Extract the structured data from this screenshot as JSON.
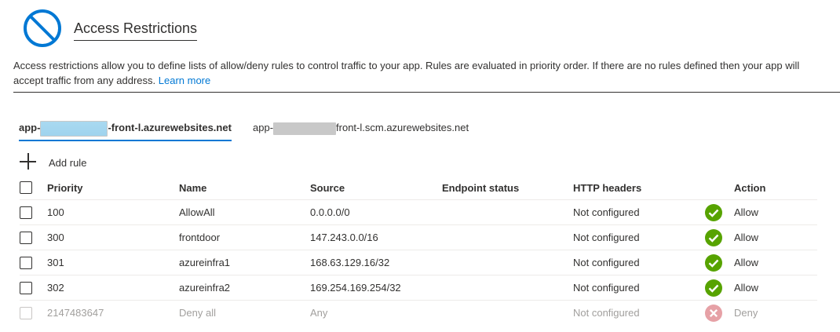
{
  "header": {
    "icon": "blocked-circle-icon",
    "title": "Access Restrictions"
  },
  "description": {
    "line1": "Access restrictions allow you to define lists of allow/deny rules to control traffic to your app. Rules are evaluated in priority order. If there are no rules defined then your app will",
    "line2": "accept traffic from any address.",
    "learn_more": "Learn more"
  },
  "tabs": [
    {
      "prefix": "app-",
      "suffix": "-front-l.azurewebsites.net",
      "selected": true
    },
    {
      "prefix": "app-",
      "suffix": "front-l.scm.azurewebsites.net",
      "selected": false
    }
  ],
  "toolbar": {
    "add_rule_label": "Add rule",
    "add_icon": "plus-icon"
  },
  "table": {
    "columns": {
      "priority": "Priority",
      "name": "Name",
      "source": "Source",
      "endpoint_status": "Endpoint status",
      "http_headers": "HTTP headers",
      "action": "Action"
    },
    "rows": [
      {
        "priority": "100",
        "name": "AllowAll",
        "source": "0.0.0.0/0",
        "endpoint_status": "",
        "http_headers": "Not configured",
        "action": "Allow",
        "action_icon": "check-circle-icon"
      },
      {
        "priority": "300",
        "name": "frontdoor",
        "source": "147.243.0.0/16",
        "endpoint_status": "",
        "http_headers": "Not configured",
        "action": "Allow",
        "action_icon": "check-circle-icon"
      },
      {
        "priority": "301",
        "name": "azureinfra1",
        "source": "168.63.129.16/32",
        "endpoint_status": "",
        "http_headers": "Not configured",
        "action": "Allow",
        "action_icon": "check-circle-icon"
      },
      {
        "priority": "302",
        "name": "azureinfra2",
        "source": "169.254.169.254/32",
        "endpoint_status": "",
        "http_headers": "Not configured",
        "action": "Allow",
        "action_icon": "check-circle-icon"
      },
      {
        "priority": "2147483647",
        "name": "Deny all",
        "source": "Any",
        "endpoint_status": "",
        "http_headers": "Not configured",
        "action": "Deny",
        "action_icon": "x-circle-icon"
      }
    ]
  },
  "colors": {
    "accent": "#0078d4",
    "allow": "#57a300",
    "deny": "#e6a1a6",
    "text": "#323130",
    "muted": "#a19f9d"
  }
}
